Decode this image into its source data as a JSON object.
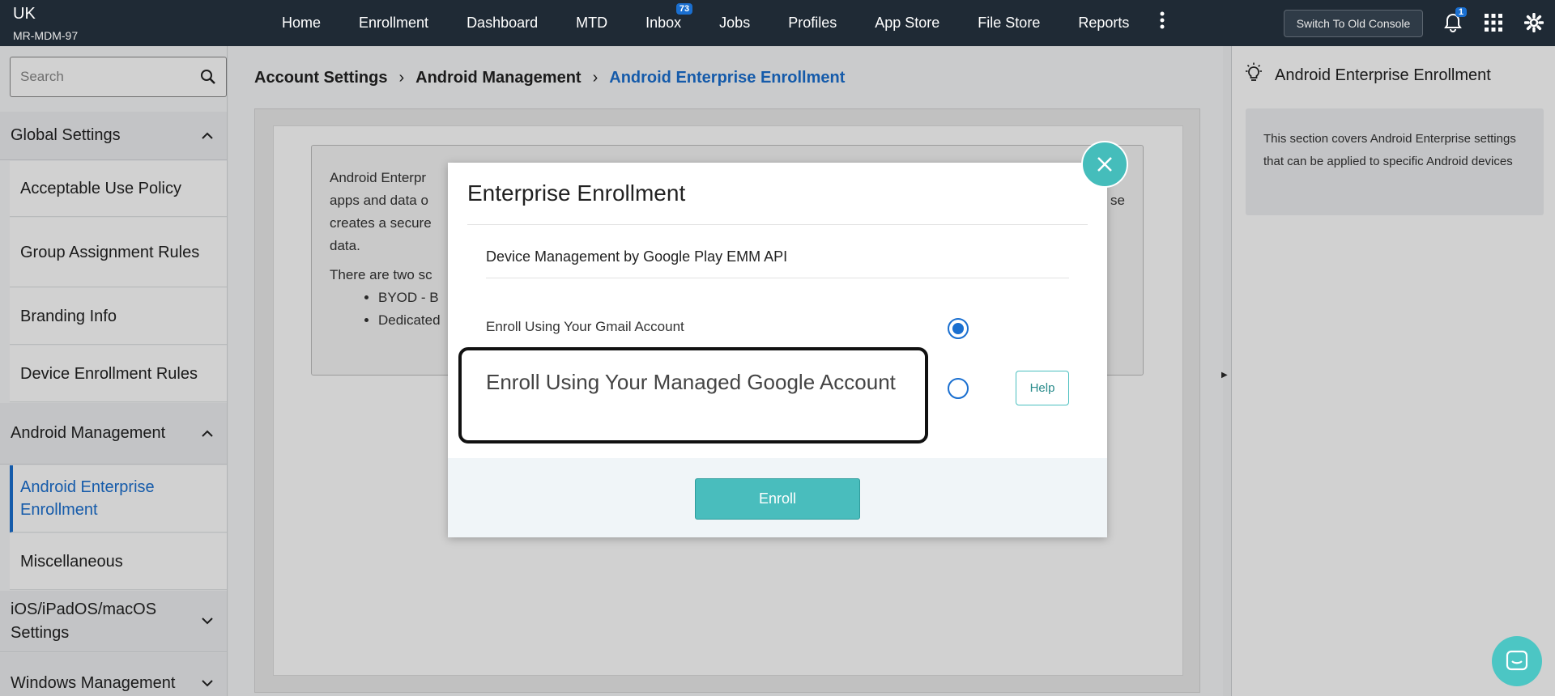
{
  "org": {
    "name": "UK",
    "code": "MR-MDM-97"
  },
  "nav": {
    "items": [
      "Home",
      "Enrollment",
      "Dashboard",
      "MTD",
      "Inbox",
      "Jobs",
      "Profiles",
      "App Store",
      "File Store",
      "Reports"
    ],
    "inbox_badge": "73",
    "switch_console": "Switch To Old Console",
    "bell_badge": "1",
    "icons": [
      "more-vertical-icon",
      "bell-icon",
      "apps-grid-icon",
      "gear-icon"
    ]
  },
  "sidebar": {
    "search_placeholder": "Search",
    "global_settings": "Global Settings",
    "global_items": [
      "Acceptable Use Policy",
      "Group Assignment Rules",
      "Branding Info",
      "Device Enrollment Rules"
    ],
    "android_management": "Android Management",
    "android_items": [
      "Android Enterprise Enrollment",
      "Miscellaneous"
    ],
    "ios_settings": "iOS/iPadOS/macOS Settings",
    "windows_management": "Windows Management"
  },
  "breadcrumb": {
    "items": [
      "Account Settings",
      "Android Management"
    ],
    "current": "Android Enterprise Enrollment",
    "separator": "›"
  },
  "info": {
    "line1": "Android Enterpr",
    "line2": "apps and data o",
    "line3": "creates a secure",
    "line4": "data.",
    "right_fragment": "se",
    "two_scenarios": "There are two sc",
    "bullets": [
      "BYOD - B",
      "Dedicated"
    ]
  },
  "modal": {
    "title": "Enterprise Enrollment",
    "subtitle": "Device Management by Google Play EMM API",
    "option1": "Enroll Using Your Gmail Account",
    "option2": "Enroll Using Your Managed Google Account",
    "selected": "option1",
    "help": "Help",
    "enroll": "Enroll"
  },
  "help_panel": {
    "title": "Android Enterprise Enrollment",
    "description": "This section covers Android Enterprise settings that can be applied to specific Android devices"
  },
  "colors": {
    "topbar": "#1f2a35",
    "accent": "#1a6fd0",
    "teal": "#49bdbd"
  }
}
